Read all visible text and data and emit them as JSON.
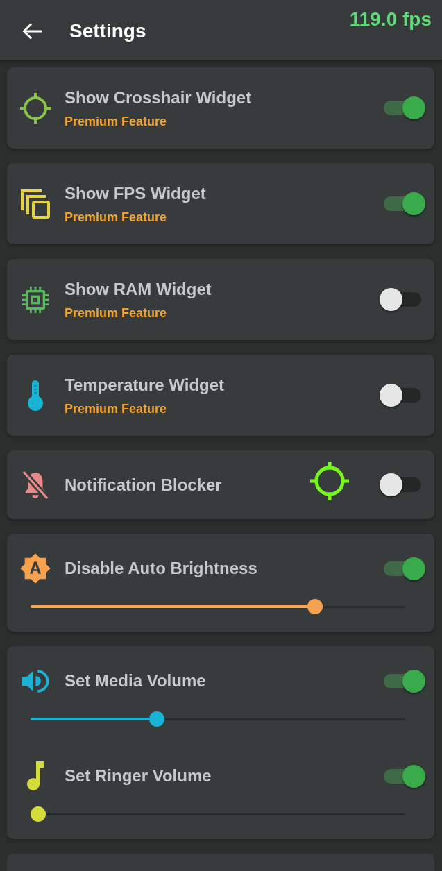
{
  "header": {
    "title": "Settings",
    "fps": "119.0 fps"
  },
  "cards": [
    {
      "rows": [
        {
          "kind": "toggle",
          "title": "Show Crosshair Widget",
          "subtitle": "Premium Feature",
          "on": true
        }
      ]
    },
    {
      "rows": [
        {
          "kind": "toggle",
          "title": "Show FPS Widget",
          "subtitle": "Premium Feature",
          "on": true
        }
      ]
    },
    {
      "rows": [
        {
          "kind": "toggle",
          "title": "Show RAM Widget",
          "subtitle": "Premium Feature",
          "on": false
        }
      ]
    },
    {
      "rows": [
        {
          "kind": "toggle",
          "title": "Temperature Widget",
          "subtitle": "Premium Feature",
          "on": false
        }
      ]
    },
    {
      "rows": [
        {
          "kind": "toggle",
          "title": "Notification Blocker",
          "on": false
        }
      ]
    },
    {
      "rows": [
        {
          "kind": "slider",
          "title": "Disable Auto Brightness",
          "on": true,
          "slider": {
            "level": 0.77
          }
        }
      ]
    },
    {
      "rows": [
        {
          "kind": "slider",
          "title": "Set Media Volume",
          "on": true,
          "slider": {
            "level": 0.33
          }
        },
        {
          "kind": "slider",
          "title": "Set Ringer Volume",
          "on": true,
          "slider": {
            "level": 0
          }
        }
      ]
    }
  ]
}
